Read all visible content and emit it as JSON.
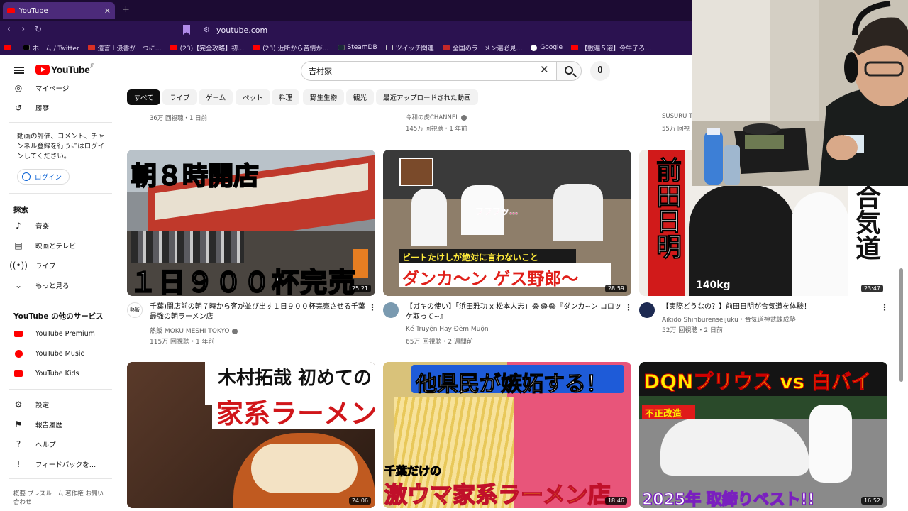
{
  "browser": {
    "tab_title": "YouTube",
    "url": "youtube.com",
    "bookmarks": [
      {
        "label": "ホーム / Twitter",
        "color": "#000000"
      },
      {
        "label": "遺言＋汲書が一つに…",
        "color": "#d93025"
      },
      {
        "label": "(23)【完全攻略】初…",
        "color": "#ff0000"
      },
      {
        "label": "(23) 近所から苦情が…",
        "color": "#ff0000"
      },
      {
        "label": "SteamDB",
        "color": "#1b2838"
      },
      {
        "label": "ツイッチ関連",
        "color": "#9146ff"
      },
      {
        "label": "全国のラーメン遍必見…",
        "color": "#c62828"
      },
      {
        "label": "Google",
        "color": "#4285f4"
      },
      {
        "label": "【敷遍５選】今牛子ろ…",
        "color": "#ff0000"
      }
    ]
  },
  "masthead": {
    "logo": "YouTube",
    "logo_region": "JP",
    "search_query": "吉村家"
  },
  "sidebar": {
    "items_top": [
      {
        "label": "マイページ",
        "icon": "my-page-icon"
      },
      {
        "label": "履歴",
        "icon": "history-icon"
      }
    ],
    "signin_text": "動画の評価、コメント、チャンネル登録を行うにはログインしてください。",
    "login_label": "ログイン",
    "explore_heading": "探索",
    "explore_items": [
      {
        "label": "音楽",
        "icon": "music-icon"
      },
      {
        "label": "映画とテレビ",
        "icon": "movies-icon"
      },
      {
        "label": "ライブ",
        "icon": "live-icon"
      },
      {
        "label": "もっと見る",
        "icon": "chevron-down-icon"
      }
    ],
    "services_heading": "YouTube の他のサービス",
    "services": [
      {
        "label": "YouTube Premium"
      },
      {
        "label": "YouTube Music"
      },
      {
        "label": "YouTube Kids"
      }
    ],
    "bottom_items": [
      {
        "label": "設定",
        "icon": "settings-icon"
      },
      {
        "label": "報告履歴",
        "icon": "flag-icon"
      },
      {
        "label": "ヘルプ",
        "icon": "help-icon"
      },
      {
        "label": "フィードバックを…",
        "icon": "feedback-icon"
      }
    ],
    "footer": "概要 プレスルーム 著作権 お問い合わせ"
  },
  "chips": [
    "すべて",
    "ライブ",
    "ゲーム",
    "ペット",
    "料理",
    "野生生物",
    "観光",
    "最近アップロードされた動画"
  ],
  "prev_row": [
    {
      "channel": "",
      "stats": "36万 回視聴・1 日前"
    },
    {
      "channel": "令和の虎CHANNEL",
      "stats": "145万 回視聴・1 年前"
    },
    {
      "channel": "SUSURU T",
      "stats": "55万 回視"
    }
  ],
  "videos": [
    {
      "thumb_top": "朝８時開店",
      "thumb_bottom": "１日９００杯完売",
      "duration": "25:21",
      "title": "千葉)開店前の朝７時から客が並び出す１日９００杯完売させる千葉最強の朝ラーメン店",
      "channel": "熱飯 MOKU MESHI TOKYO",
      "stats": "115万 回視聴・1 年前",
      "avatar_text": "熱飯"
    },
    {
      "thumb_top": "フフフッ…",
      "thumb_bottom": "ダンカ～ン ゲス野郎～",
      "thumb_label": "ビートたけしが絶対に言わないこと",
      "duration": "28:59",
      "title": "【ガキの使い】「浜田雅功 x 松本人志」😂😂😂『ダンカ~ン コロッケ取って~』",
      "channel": "Kể Truyện Hay Đêm Muộn",
      "stats": "65万 回視聴・2 週間前"
    },
    {
      "thumb_left": "前田日明",
      "thumb_right": "合気道",
      "thumb_weight": "140kg",
      "duration": "23:47",
      "title": "【実際どうなの？】前田日明が合気道を体験！",
      "channel": "Aikido Shinburenseijuku・合気道神武錬成塾",
      "stats": "52万 回視聴・2 日前"
    }
  ],
  "videos_row2": [
    {
      "thumb_top": "木村拓哉 初めての",
      "thumb_bottom": "家系ラーメン",
      "duration": "24:06"
    },
    {
      "thumb_top": "他県民が嫉妬する！",
      "thumb_bottom": "激ウマ家系ラーメン店",
      "thumb_small": "千葉だけの",
      "duration": "18:46"
    },
    {
      "thumb_top": "DQNプリウス vs 白バイ",
      "thumb_badge": "不正改造",
      "thumb_bottom": "2025年 取締りベスト!!",
      "duration": "16:52"
    }
  ],
  "colors": {
    "browser_tab_bg": "#1c0b33",
    "browser_bar_bg": "#2b1250",
    "yt_red": "#ff0000",
    "chip_active": "#0f0f0f"
  }
}
